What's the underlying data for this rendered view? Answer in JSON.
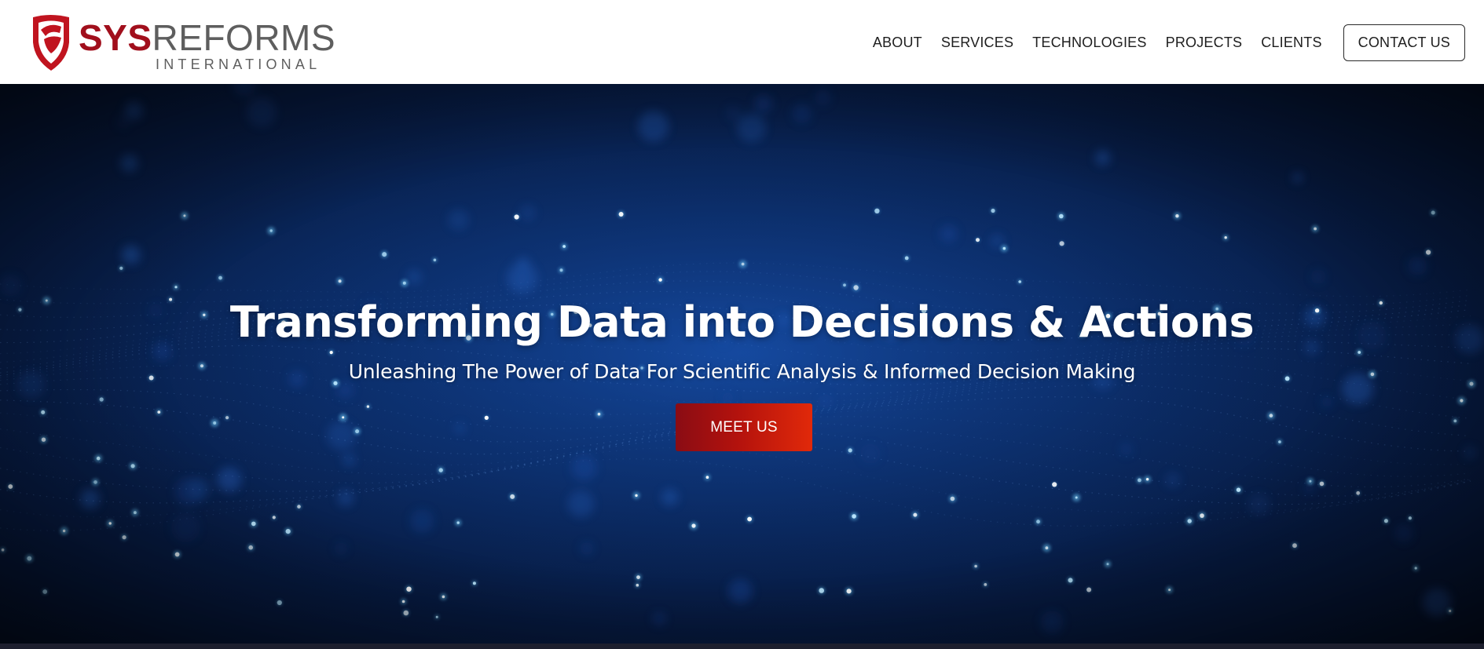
{
  "brand": {
    "name_part1": "SYS",
    "name_part2": "REFORMS",
    "tagline": "INTERNATIONAL",
    "colors": {
      "red": "#a10f1c",
      "gray": "#5e5e5e"
    }
  },
  "nav": {
    "items": [
      {
        "label": "ABOUT"
      },
      {
        "label": "SERVICES"
      },
      {
        "label": "TECHNOLOGIES"
      },
      {
        "label": "PROJECTS"
      },
      {
        "label": "CLIENTS"
      }
    ],
    "cta_label": "CONTACT US"
  },
  "hero": {
    "title": "Transforming Data into Decisions & Actions",
    "subtitle": "Unleashing The Power of Data For Scientific Analysis & Informed Decision Making",
    "button_label": "MEET US",
    "colors": {
      "background": "#0b2c66",
      "button": "#c41a0e"
    }
  }
}
